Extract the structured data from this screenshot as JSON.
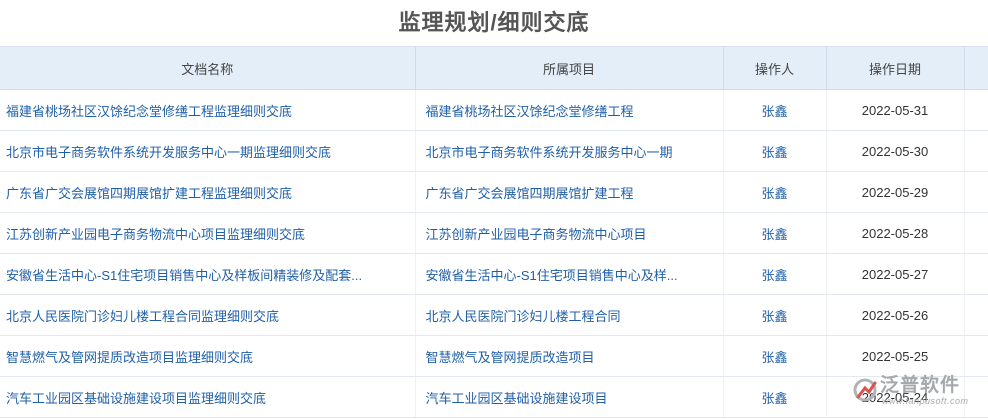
{
  "page": {
    "title": "监理规划/细则交底"
  },
  "table": {
    "columns": [
      "文档名称",
      "所属项目",
      "操作人",
      "操作日期"
    ],
    "rows": [
      {
        "name": "福建省桃场社区汉馀纪念堂修缮工程监理细则交底",
        "project": "福建省桃场社区汉馀纪念堂修缮工程",
        "operator": "张鑫",
        "date": "2022-05-31"
      },
      {
        "name": "北京市电子商务软件系统开发服务中心一期监理细则交底",
        "project": "北京市电子商务软件系统开发服务中心一期",
        "operator": "张鑫",
        "date": "2022-05-30"
      },
      {
        "name": "广东省广交会展馆四期展馆扩建工程监理细则交底",
        "project": "广东省广交会展馆四期展馆扩建工程",
        "operator": "张鑫",
        "date": "2022-05-29"
      },
      {
        "name": "江苏创新产业园电子商务物流中心项目监理细则交底",
        "project": "江苏创新产业园电子商务物流中心项目",
        "operator": "张鑫",
        "date": "2022-05-28"
      },
      {
        "name": "安徽省生活中心-S1住宅项目销售中心及样板间精装修及配套...",
        "project": "安徽省生活中心-S1住宅项目销售中心及样...",
        "operator": "张鑫",
        "date": "2022-05-27"
      },
      {
        "name": "北京人民医院门诊妇儿楼工程合同监理细则交底",
        "project": "北京人民医院门诊妇儿楼工程合同",
        "operator": "张鑫",
        "date": "2022-05-26"
      },
      {
        "name": "智慧燃气及管网提质改造项目监理细则交底",
        "project": "智慧燃气及管网提质改造项目",
        "operator": "张鑫",
        "date": "2022-05-25"
      },
      {
        "name": "汽车工业园区基础设施建设项目监理细则交底",
        "project": "汽车工业园区基础设施建设项目",
        "operator": "张鑫",
        "date": "2022-05-24"
      }
    ]
  },
  "watermark": {
    "name": "泛普软件",
    "url": "www.fanpusoft.com"
  },
  "colors": {
    "header_bg": "#e4eef8",
    "link": "#1f5fa8",
    "title": "#555555"
  }
}
